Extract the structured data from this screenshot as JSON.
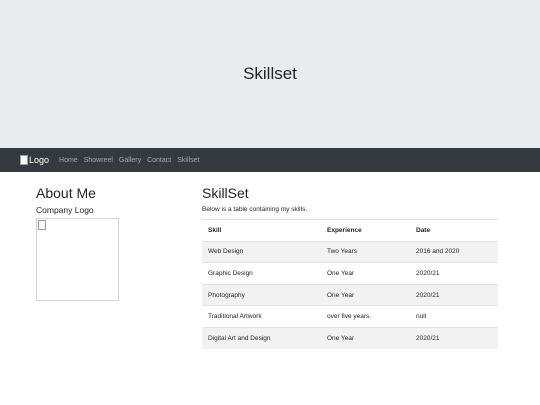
{
  "hero": {
    "title": "Skillset"
  },
  "navbar": {
    "brand_alt": "Logo",
    "links": [
      "Home",
      "Showreel",
      "Gallery",
      "Contact",
      "Skillset"
    ]
  },
  "about": {
    "title": "About Me",
    "subtitle": "Company Logo"
  },
  "skills": {
    "title": "SkillSet",
    "description": "Below is a table containing my skills.",
    "headers": [
      "Skill",
      "Experience",
      "Date"
    ],
    "rows": [
      [
        "Web Design",
        "Two Years",
        "2016 and 2020"
      ],
      [
        "Graphic Design",
        "One Year",
        "2020/21"
      ],
      [
        "Photography",
        "One Year",
        "2020/21"
      ],
      [
        "Traditional Artwork",
        "over five years.",
        "null"
      ],
      [
        "Digital Art and Design",
        "One Year",
        "2020/21"
      ]
    ]
  }
}
